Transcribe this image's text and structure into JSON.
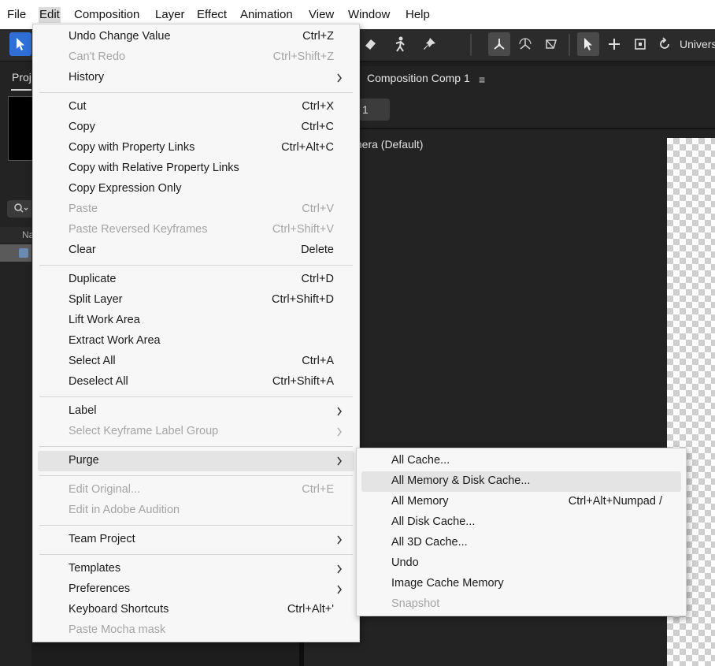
{
  "menubar": {
    "items": [
      "File",
      "Edit",
      "Composition",
      "Layer",
      "Effect",
      "Animation",
      "View",
      "Window",
      "Help"
    ],
    "active": "Edit"
  },
  "toolbar": {
    "workspace_label": "Univers"
  },
  "project_panel": {
    "tab_label": "Proj",
    "column_label": "Na"
  },
  "composition_panel": {
    "tab_label": "Composition Comp 1",
    "tab_menu_glyph": "≡",
    "view_field": "1",
    "camera_label": "mera (Default)"
  },
  "edit_menu": {
    "items": [
      {
        "label": "Undo Change Value",
        "shortcut": "Ctrl+Z",
        "enabled": true,
        "submenu": false
      },
      {
        "label": "Can't Redo",
        "shortcut": "Ctrl+Shift+Z",
        "enabled": false,
        "submenu": false
      },
      {
        "label": "History",
        "shortcut": "",
        "enabled": true,
        "submenu": true
      },
      {
        "label": "Cut",
        "shortcut": "Ctrl+X",
        "enabled": true,
        "submenu": false
      },
      {
        "label": "Copy",
        "shortcut": "Ctrl+C",
        "enabled": true,
        "submenu": false
      },
      {
        "label": "Copy with Property Links",
        "shortcut": "Ctrl+Alt+C",
        "enabled": true,
        "submenu": false
      },
      {
        "label": "Copy with Relative Property Links",
        "shortcut": "",
        "enabled": true,
        "submenu": false
      },
      {
        "label": "Copy Expression Only",
        "shortcut": "",
        "enabled": true,
        "submenu": false
      },
      {
        "label": "Paste",
        "shortcut": "Ctrl+V",
        "enabled": false,
        "submenu": false
      },
      {
        "label": "Paste Reversed Keyframes",
        "shortcut": "Ctrl+Shift+V",
        "enabled": false,
        "submenu": false
      },
      {
        "label": "Clear",
        "shortcut": "Delete",
        "enabled": true,
        "submenu": false
      },
      {
        "label": "Duplicate",
        "shortcut": "Ctrl+D",
        "enabled": true,
        "submenu": false
      },
      {
        "label": "Split Layer",
        "shortcut": "Ctrl+Shift+D",
        "enabled": true,
        "submenu": false
      },
      {
        "label": "Lift Work Area",
        "shortcut": "",
        "enabled": true,
        "submenu": false
      },
      {
        "label": "Extract Work Area",
        "shortcut": "",
        "enabled": true,
        "submenu": false
      },
      {
        "label": "Select All",
        "shortcut": "Ctrl+A",
        "enabled": true,
        "submenu": false
      },
      {
        "label": "Deselect All",
        "shortcut": "Ctrl+Shift+A",
        "enabled": true,
        "submenu": false
      },
      {
        "label": "Label",
        "shortcut": "",
        "enabled": true,
        "submenu": true
      },
      {
        "label": "Select Keyframe Label Group",
        "shortcut": "",
        "enabled": false,
        "submenu": true
      },
      {
        "label": "Purge",
        "shortcut": "",
        "enabled": true,
        "submenu": true,
        "highlighted": true
      },
      {
        "label": "Edit Original...",
        "shortcut": "Ctrl+E",
        "enabled": false,
        "submenu": false
      },
      {
        "label": "Edit in Adobe Audition",
        "shortcut": "",
        "enabled": false,
        "submenu": false
      },
      {
        "label": "Team Project",
        "shortcut": "",
        "enabled": true,
        "submenu": true
      },
      {
        "label": "Templates",
        "shortcut": "",
        "enabled": true,
        "submenu": true
      },
      {
        "label": "Preferences",
        "shortcut": "",
        "enabled": true,
        "submenu": true
      },
      {
        "label": "Keyboard Shortcuts",
        "shortcut": "Ctrl+Alt+'",
        "enabled": true,
        "submenu": false
      },
      {
        "label": "Paste Mocha mask",
        "shortcut": "",
        "enabled": false,
        "submenu": false
      }
    ]
  },
  "purge_submenu": {
    "items": [
      {
        "label": "All Cache...",
        "shortcut": "",
        "enabled": true
      },
      {
        "label": "All Memory & Disk Cache...",
        "shortcut": "",
        "enabled": true,
        "highlighted": true
      },
      {
        "label": "All Memory",
        "shortcut": "Ctrl+Alt+Numpad /",
        "enabled": true
      },
      {
        "label": "All Disk Cache...",
        "shortcut": "",
        "enabled": true
      },
      {
        "label": "All 3D Cache...",
        "shortcut": "",
        "enabled": true
      },
      {
        "label": "Undo",
        "shortcut": "",
        "enabled": true
      },
      {
        "label": "Image Cache Memory",
        "shortcut": "",
        "enabled": true
      },
      {
        "label": "Snapshot",
        "shortcut": "",
        "enabled": false
      }
    ]
  }
}
